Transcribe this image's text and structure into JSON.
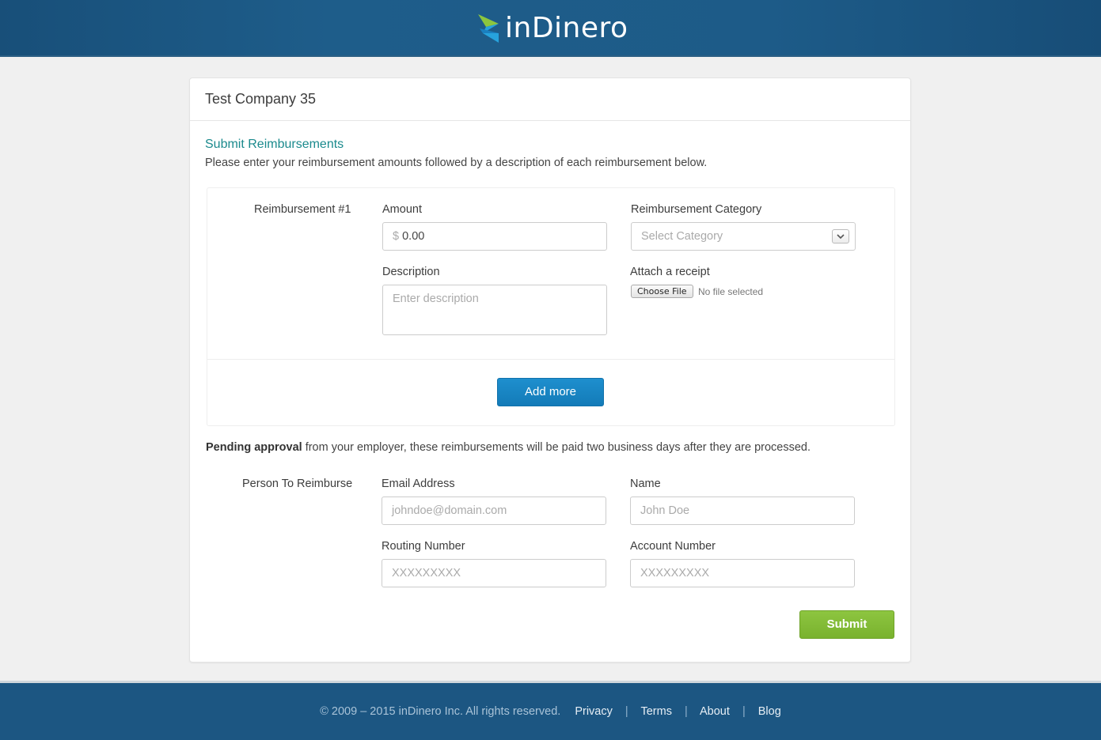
{
  "brand": {
    "name": "inDinero"
  },
  "card": {
    "company": "Test Company 35",
    "section_title": "Submit Reimbursements",
    "section_desc": "Please enter your reimbursement amounts followed by a description of each reimbursement below."
  },
  "reimbursement": {
    "label": "Reimbursement #1",
    "amount_label": "Amount",
    "amount_prefix": "$",
    "amount_value": "0.00",
    "category_label": "Reimbursement Category",
    "category_placeholder": "Select Category",
    "description_label": "Description",
    "description_placeholder": "Enter description",
    "receipt_label": "Attach a receipt",
    "choose_file": "Choose File",
    "no_file": "No file selected",
    "add_more": "Add more"
  },
  "pending": {
    "bold": "Pending approval",
    "rest": " from your employer, these reimbursements will be paid two business days after they are processed."
  },
  "person": {
    "label": "Person To Reimburse",
    "email_label": "Email Address",
    "email_placeholder": "johndoe@domain.com",
    "name_label": "Name",
    "name_placeholder": "John Doe",
    "routing_label": "Routing Number",
    "routing_placeholder": "XXXXXXXXX",
    "account_label": "Account Number",
    "account_placeholder": "XXXXXXXXX",
    "submit": "Submit"
  },
  "footer": {
    "copyright": "© 2009 – 2015 inDinero Inc. All rights reserved.",
    "links": [
      "Privacy",
      "Terms",
      "About",
      "Blog"
    ],
    "separator": "|"
  },
  "colors": {
    "header_bg": "#1d5b88",
    "accent_teal": "#1b8a8d",
    "button_blue": "#1685c4",
    "button_green": "#82bb36"
  },
  "icons": {
    "logo": "indinero-arrow-logo-icon",
    "select_caret": "chevron-down-icon"
  }
}
